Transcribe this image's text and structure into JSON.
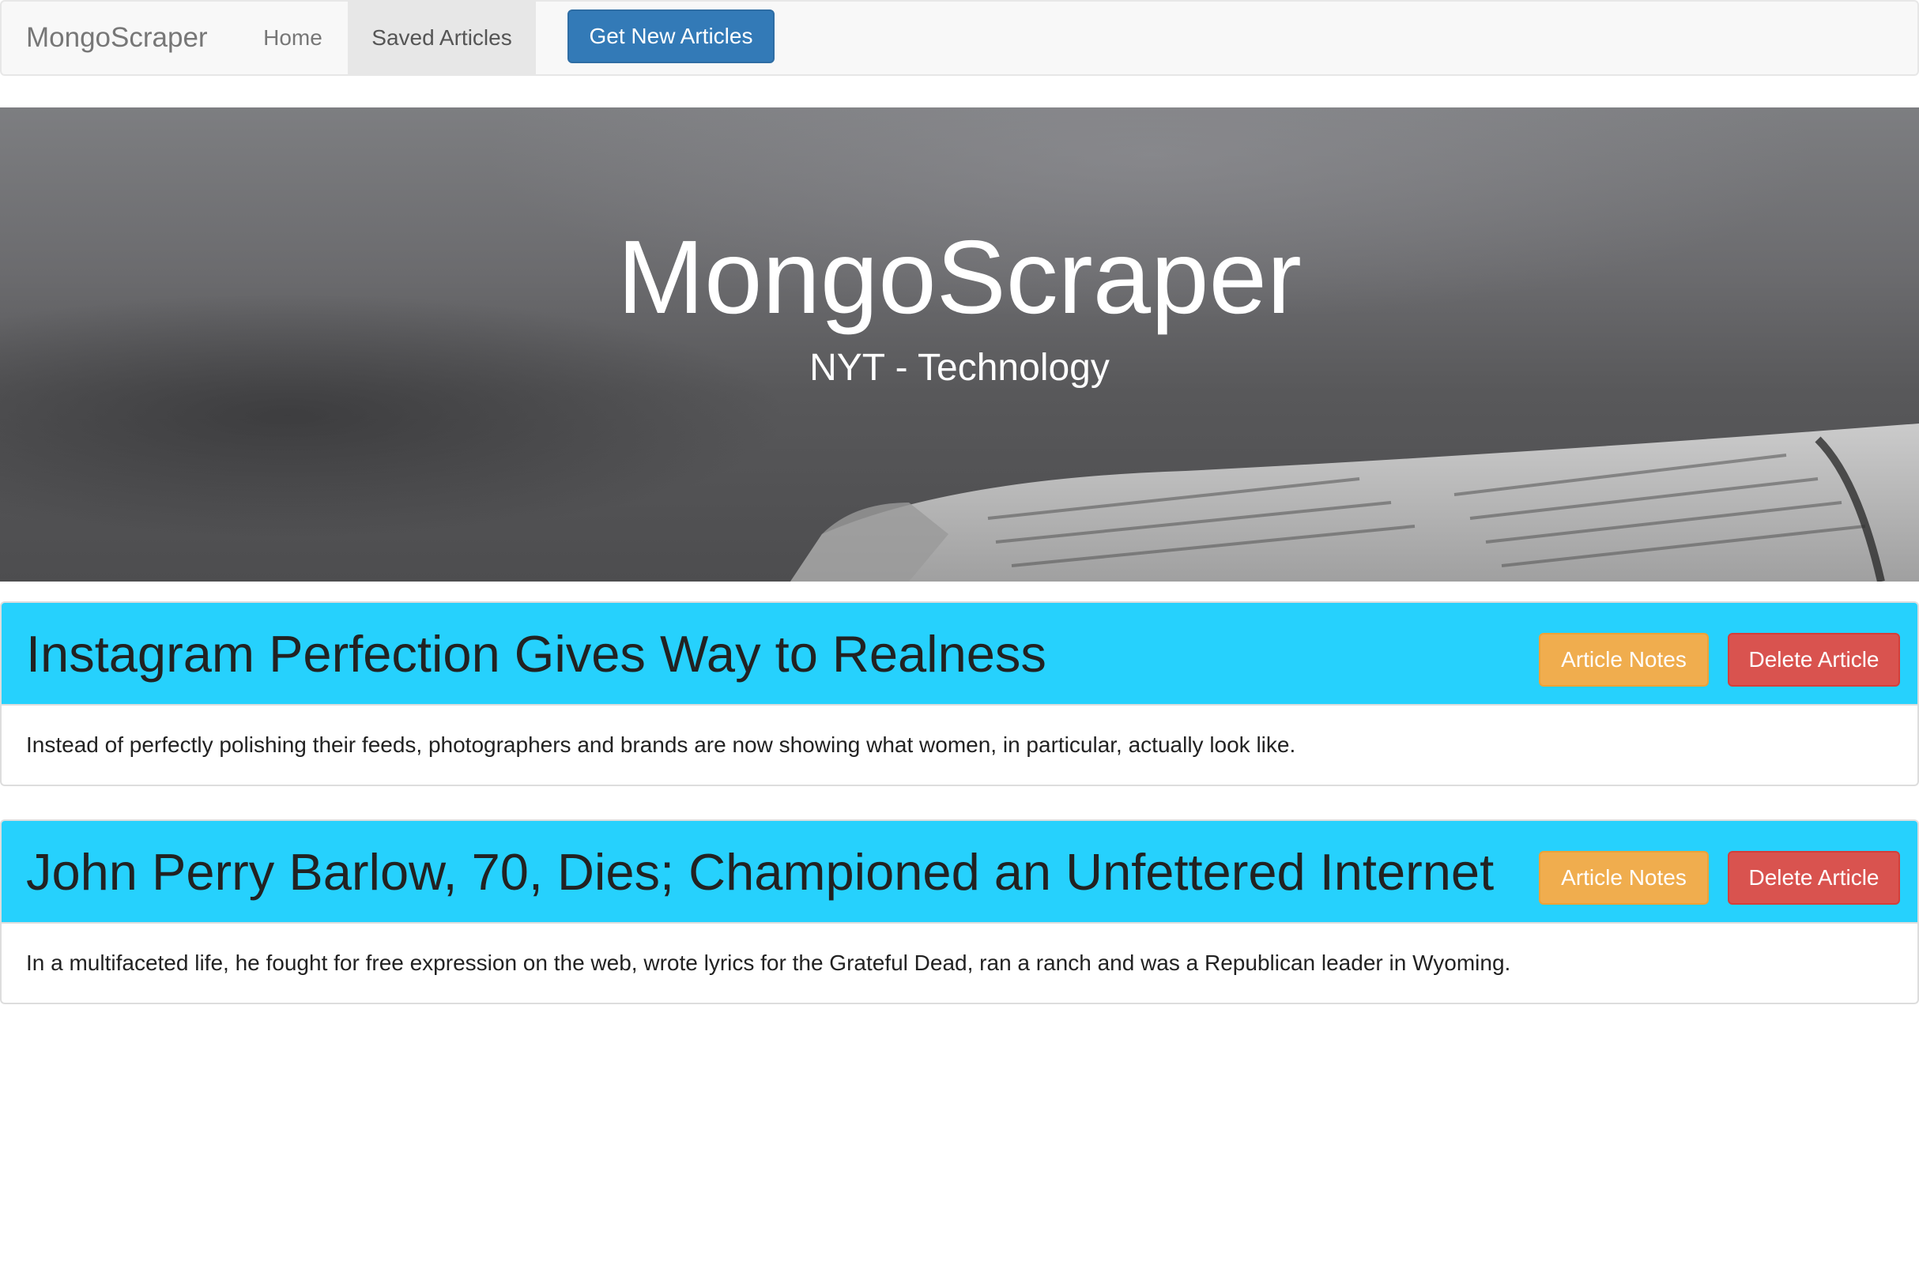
{
  "navbar": {
    "brand": "MongoScraper",
    "links": [
      {
        "label": "Home",
        "active": false
      },
      {
        "label": "Saved Articles",
        "active": true
      }
    ],
    "get_new_button": "Get New Articles"
  },
  "jumbotron": {
    "title": "MongoScraper",
    "subtitle": "NYT - Technology"
  },
  "articles": [
    {
      "title": "Instagram Perfection Gives Way to Realness",
      "summary": "Instead of perfectly polishing their feeds, photographers and brands are now showing what women, in particular, actually look like.",
      "notes_button": "Article Notes",
      "delete_button": "Delete Article"
    },
    {
      "title": "John Perry Barlow, 70, Dies; Championed an Unfettered Internet",
      "summary": "In a multifaceted life, he fought for free expression on the web, wrote lyrics for the Grateful Dead, ran a ranch and was a Republican leader in Wyoming.",
      "notes_button": "Article Notes",
      "delete_button": "Delete Article"
    }
  ],
  "colors": {
    "panel_heading": "#26d1fd",
    "primary": "#337ab7",
    "warning": "#f0ad4e",
    "danger": "#d9534f"
  }
}
